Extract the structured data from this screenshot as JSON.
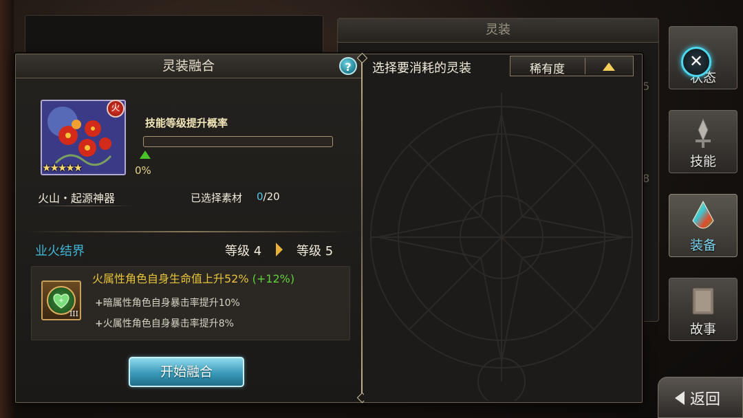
{
  "background": {
    "top_panel_title": "灵装",
    "side_digits": [
      "5",
      "8"
    ]
  },
  "dialog": {
    "title": "灵装融合",
    "help_label": "?",
    "card": {
      "name": "火山・起源神器",
      "rarity_stars": "★★★★★",
      "element_badge": "fire-icon",
      "element_badge_glyph": "火"
    },
    "skill_rate": {
      "label": "技能等级提升概率",
      "value_text": "0%",
      "progress": 0
    },
    "selected_materials": {
      "label": "已选择素材",
      "current": "0",
      "max": "/20"
    },
    "skill": {
      "name": "业火结界",
      "level_from": "等级 4",
      "level_to": "等级 5"
    },
    "effect": {
      "icon": "heart-heal-icon",
      "icon_roman": "III",
      "main_text": "火属性角色自身生命值上升52% ",
      "main_bonus": "(+12%)",
      "sub_effects": [
        {
          "plus": "+",
          "text": "暗属性角色自身暴击率提升10%"
        },
        {
          "plus": "+",
          "text": "火属性角色自身暴击率提升8%"
        }
      ]
    },
    "fuse_button": "开始融合",
    "right": {
      "header": "选择要消耗的灵装",
      "sort_label": "稀有度",
      "sort_direction": "ascending-arrow-icon"
    }
  },
  "side_menu": [
    {
      "label": "状态",
      "icon": "status-icon"
    },
    {
      "label": "技能",
      "icon": "skill-sword-icon"
    },
    {
      "label": "装备",
      "icon": "crystal-icon"
    },
    {
      "label": "故事",
      "icon": "book-icon"
    }
  ],
  "close_label": "✕",
  "back_label": "返回",
  "colors": {
    "accent_cyan": "#3fb7d8",
    "effect_gold": "#e8c43a",
    "bonus_green": "#5fd23a"
  }
}
